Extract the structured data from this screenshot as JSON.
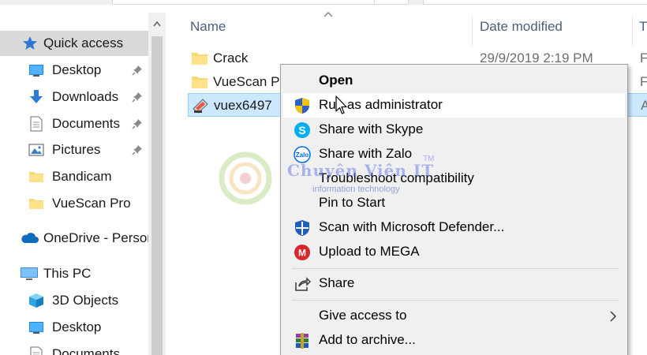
{
  "nav": {
    "items": [
      {
        "label": "Quick access",
        "icon": "star-icon",
        "pinned": false,
        "selected": true
      },
      {
        "label": "Desktop",
        "icon": "desktop-icon",
        "pinned": true
      },
      {
        "label": "Downloads",
        "icon": "download-icon",
        "pinned": true
      },
      {
        "label": "Documents",
        "icon": "document-icon",
        "pinned": true
      },
      {
        "label": "Pictures",
        "icon": "pictures-icon",
        "pinned": true
      },
      {
        "label": "Bandicam",
        "icon": "folder-icon",
        "pinned": false
      },
      {
        "label": "VueScan Pro",
        "icon": "folder-icon",
        "pinned": false
      },
      {
        "label": "OneDrive - Persor",
        "icon": "cloud-icon",
        "pinned": false
      },
      {
        "label": "This PC",
        "icon": "computer-icon",
        "pinned": false
      },
      {
        "label": "3D Objects",
        "icon": "cube-icon",
        "pinned": false
      },
      {
        "label": "Desktop",
        "icon": "desktop-icon",
        "pinned": false
      },
      {
        "label": "Documents",
        "icon": "document-icon",
        "pinned": false
      }
    ]
  },
  "columns": {
    "name": "Name",
    "date": "Date modified",
    "type": "Ty"
  },
  "files": [
    {
      "name": "Crack",
      "date": "29/9/2019 2:19 PM",
      "type": "F",
      "icon": "folder-icon"
    },
    {
      "name": "VueScan Pr",
      "date": "",
      "type": "F",
      "icon": "folder-icon"
    },
    {
      "name": "vuex6497",
      "date": "",
      "type": "A",
      "icon": "vuescan-app-icon",
      "selected": true
    }
  ],
  "context_menu": {
    "items": [
      {
        "label": "Open",
        "bold": true,
        "icon": ""
      },
      {
        "label": "Run as administrator",
        "icon": "uac-shield-icon",
        "hover": true
      },
      {
        "label": "Share with Skype",
        "icon": "skype-icon"
      },
      {
        "label": "Share with Zalo",
        "icon": "zalo-icon"
      },
      {
        "label": "Troubleshoot compatibility",
        "icon": ""
      },
      {
        "label": "Pin to Start",
        "icon": ""
      },
      {
        "label": "Scan with Microsoft Defender...",
        "icon": "defender-icon"
      },
      {
        "label": "Upload to MEGA",
        "icon": "mega-icon"
      },
      {
        "label": "Share",
        "icon": "share-icon"
      },
      {
        "label": "Give access to",
        "icon": "",
        "submenu": true
      },
      {
        "label": "Add to archive...",
        "icon": "winrar-icon"
      }
    ]
  },
  "watermark": {
    "title": "Chuyên Viên IT",
    "tm": "TM",
    "subtitle": "information technology"
  },
  "colors": {
    "selection": "#cce8ff",
    "nav_selected": "#d9d9d9",
    "menu_bg": "#f0f0f0",
    "header_text": "#4c607a"
  }
}
